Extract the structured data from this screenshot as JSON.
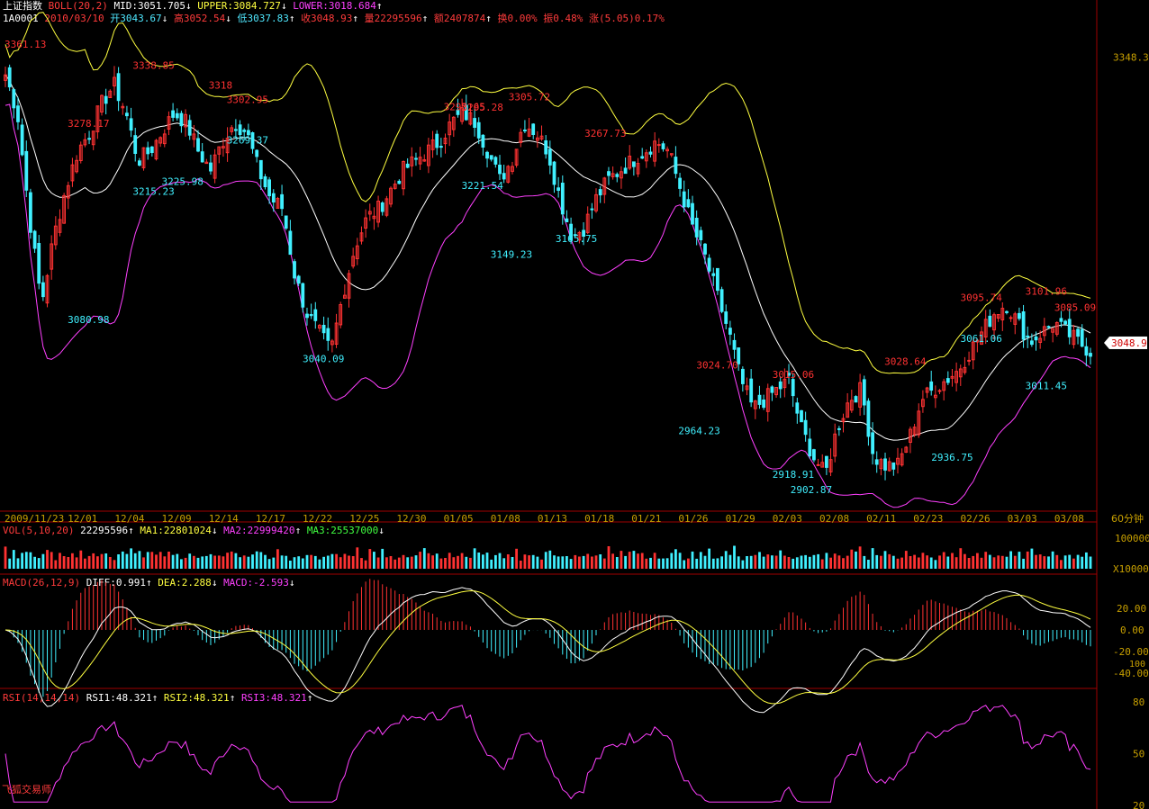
{
  "header": {
    "index_name": "上证指数",
    "indicator": "BOLL(20,2)",
    "mid": "MID:3051.705",
    "mid_arrow": "↓",
    "upper": "UPPER:3084.727",
    "upper_arrow": "↓",
    "lower": "LOWER:3018.684",
    "lower_arrow": "↑",
    "code": "1A0001",
    "date": "2010/03/10",
    "open": "开3043.67",
    "open_arrow": "↓",
    "high": "高3052.54",
    "high_arrow": "↓",
    "low": "低3037.83",
    "low_arrow": "↑",
    "close": "收3048.93",
    "close_arrow": "↑",
    "volume": "量22295596",
    "volume_arrow": "↑",
    "amount": "额2407874",
    "amount_arrow": "↑",
    "turnover": "换0.00%",
    "amplitude": "振0.48%",
    "change": "涨(5.05)0.17%"
  },
  "vol_header": {
    "indicator": "VOL(5,10,20)",
    "value": "22295596",
    "value_arrow": "↑",
    "ma1": "MA1:22801024",
    "ma1_arrow": "↓",
    "ma2": "MA2:22999420",
    "ma2_arrow": "↑",
    "ma3": "MA3:25537000",
    "ma3_arrow": "↓"
  },
  "macd_header": {
    "indicator": "MACD(26,12,9)",
    "diff": "DIFF:0.991",
    "diff_arrow": "↑",
    "dea": "DEA:2.288",
    "dea_arrow": "↓",
    "macd": "MACD:-2.593",
    "macd_arrow": "↓"
  },
  "rsi_header": {
    "indicator": "RSI(14,14,14)",
    "rsi1": "RSI1:48.321",
    "rsi1_arrow": "↑",
    "rsi2": "RSI2:48.321",
    "rsi2_arrow": "↑",
    "rsi3": "RSI3:48.321",
    "rsi3_arrow": "↑"
  },
  "period_label": "60分钟",
  "brand": "飞狐交易师",
  "colors": {
    "up": "#ff3232",
    "down": "#40f0ff",
    "upper_band": "#ffff40",
    "mid_band": "#ffffff",
    "lower_band": "#ff40ff",
    "axis": "#a00000",
    "axis_text": "#c8a000"
  },
  "chart_data": [
    {
      "type": "candlestick",
      "title": "上证指数 BOLL(20,2)",
      "x_ticks": [
        "2009/11/23",
        "12/01",
        "12/04",
        "12/09",
        "12/14",
        "12/17",
        "12/22",
        "12/25",
        "12/30",
        "01/05",
        "01/08",
        "01/13",
        "01/18",
        "01/21",
        "01/26",
        "01/29",
        "02/03",
        "02/08",
        "02/11",
        "02/23",
        "02/26",
        "03/03",
        "03/08"
      ],
      "y_axis_label_right": "3348.3",
      "last_price_tag": "3048.9",
      "peak_labels": [
        {
          "text": "3361.13",
          "x_ref": "2009/11/23",
          "value": 3361.13
        },
        {
          "text": "3338.85",
          "x_ref": "12/04",
          "value": 3338.85
        },
        {
          "text": "3278.17",
          "x_ref": "12/01",
          "value": 3278.17
        },
        {
          "text": "3302.95",
          "x_ref": "12/14",
          "value": 3302.95
        },
        {
          "text": "3318",
          "x_ref": "12/14",
          "value": 3318
        },
        {
          "text": "3295.28",
          "x_ref": "01/05",
          "value": 3295.28
        },
        {
          "text": "3295.65",
          "x_ref": "01/05",
          "value": 3295.65
        },
        {
          "text": "3305.72",
          "x_ref": "01/08",
          "value": 3305.72
        },
        {
          "text": "3267.73",
          "x_ref": "01/18",
          "value": 3267.73
        },
        {
          "text": "3024.70",
          "x_ref": "01/26",
          "value": 3024.7
        },
        {
          "text": "3015.06",
          "x_ref": "02/03",
          "value": 3015.06
        },
        {
          "text": "3028.64",
          "x_ref": "02/11",
          "value": 3028.64
        },
        {
          "text": "3095.74",
          "x_ref": "02/26",
          "value": 3095.74
        },
        {
          "text": "3101.96",
          "x_ref": "03/03",
          "value": 3101.96
        },
        {
          "text": "3085.09",
          "x_ref": "03/08",
          "value": 3085.09
        }
      ],
      "trough_labels": [
        {
          "text": "3080.98",
          "x_ref": "12/01",
          "value": 3080.98
        },
        {
          "text": "3215.23",
          "x_ref": "12/04",
          "value": 3215.23
        },
        {
          "text": "3225.98",
          "x_ref": "12/09",
          "value": 3225.98
        },
        {
          "text": "3269.37",
          "x_ref": "12/14",
          "value": 3269.37
        },
        {
          "text": "3040.09",
          "x_ref": "12/22",
          "value": 3040.09
        },
        {
          "text": "3221.54",
          "x_ref": "01/05",
          "value": 3221.54
        },
        {
          "text": "3149.23",
          "x_ref": "01/08",
          "value": 3149.23
        },
        {
          "text": "3165.75",
          "x_ref": "01/13",
          "value": 3165.75
        },
        {
          "text": "2964.23",
          "x_ref": "01/26",
          "value": 2964.23
        },
        {
          "text": "2902.87",
          "x_ref": "02/03",
          "value": 2902.87
        },
        {
          "text": "2918.91",
          "x_ref": "02/03",
          "value": 2918.91
        },
        {
          "text": "2936.75",
          "x_ref": "02/23",
          "value": 2936.75
        },
        {
          "text": "3061.06",
          "x_ref": "02/26",
          "value": 3061.06
        },
        {
          "text": "3011.45",
          "x_ref": "03/03",
          "value": 3011.45
        }
      ],
      "close_path": [
        3330,
        3290,
        3180,
        3090,
        3160,
        3210,
        3250,
        3270,
        3300,
        3320,
        3290,
        3240,
        3250,
        3270,
        3290,
        3280,
        3250,
        3230,
        3260,
        3280,
        3270,
        3230,
        3200,
        3190,
        3120,
        3080,
        3060,
        3040,
        3100,
        3150,
        3180,
        3190,
        3210,
        3230,
        3240,
        3250,
        3260,
        3280,
        3290,
        3280,
        3250,
        3220,
        3240,
        3280,
        3270,
        3250,
        3200,
        3160,
        3170,
        3200,
        3220,
        3230,
        3240,
        3250,
        3260,
        3250,
        3210,
        3170,
        3140,
        3100,
        3060,
        3010,
        2980,
        2990,
        3000,
        3010,
        2960,
        2930,
        2910,
        2960,
        2990,
        3000,
        2930,
        2920,
        2920,
        2950,
        2990,
        3000,
        3010,
        3020,
        3040,
        3060,
        3080,
        3090,
        3070,
        3050,
        3060,
        3070,
        3060,
        3050,
        3040
      ],
      "series": [
        {
          "name": "UPPER",
          "last": 3084.727
        },
        {
          "name": "MID",
          "last": 3051.705
        },
        {
          "name": "LOWER",
          "last": 3018.684
        }
      ]
    },
    {
      "type": "bar",
      "title": "VOL(5,10,20)",
      "y_ticks": [
        "100000",
        "X10000"
      ],
      "values_relative": [
        0.7,
        0.5,
        0.6,
        0.4,
        0.5,
        0.6,
        0.5,
        0.5,
        0.4,
        0.5,
        0.6,
        0.5,
        0.4,
        0.5,
        0.5,
        0.4,
        0.5,
        0.5,
        0.6,
        0.5,
        0.4,
        0.5,
        0.6,
        0.5,
        0.7,
        0.5,
        0.4,
        0.6,
        0.5,
        0.5
      ]
    },
    {
      "type": "line",
      "title": "MACD(26,12,9)",
      "y_ticks": [
        "20.00",
        "0.00",
        "-20.00",
        "100",
        "-40.00"
      ],
      "series": [
        {
          "name": "DIFF",
          "last": 0.991
        },
        {
          "name": "DEA",
          "last": 2.288
        },
        {
          "name": "MACD",
          "last": -2.593
        }
      ]
    },
    {
      "type": "line",
      "title": "RSI(14,14,14)",
      "y_ticks": [
        "80",
        "50",
        "20"
      ],
      "series": [
        {
          "name": "RSI1",
          "last": 48.321
        },
        {
          "name": "RSI2",
          "last": 48.321
        },
        {
          "name": "RSI3",
          "last": 48.321
        }
      ]
    }
  ]
}
